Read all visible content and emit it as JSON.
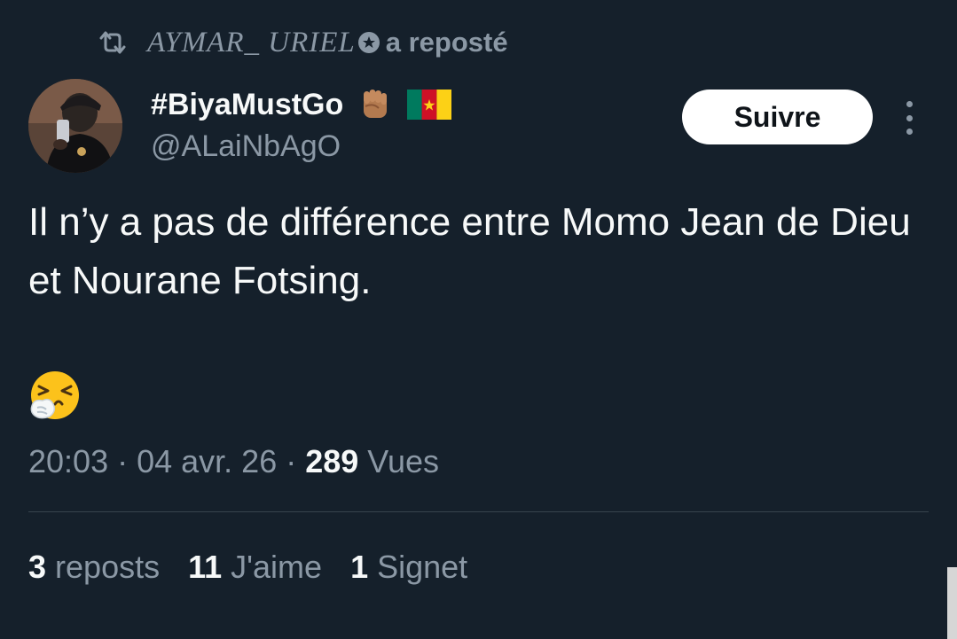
{
  "repost": {
    "reposter": "AYMAR_ URIEL",
    "action": "a reposté"
  },
  "author": {
    "display_name": "#BiyaMustGo",
    "handle": "@ALaiNbAgO"
  },
  "follow_label": "Suivre",
  "tweet": {
    "text": "Il n’y a pas de différence entre Momo Jean de Dieu et Nourane Fotsing."
  },
  "meta": {
    "time": "20:03",
    "separator": "·",
    "date": "04 avr. 26",
    "views_count": "289",
    "views_label": "Vues"
  },
  "stats": {
    "reposts_count": "3",
    "reposts_label": "reposts",
    "likes_count": "11",
    "likes_label": "J'aime",
    "bookmarks_count": "1",
    "bookmarks_label": "Signet"
  },
  "icons": {
    "repost": "repost-icon",
    "badge": "badge-icon",
    "fist": "raised-fist-emoji",
    "flag": "cameroon-flag-emoji",
    "sneeze": "sneezing-face-emoji",
    "more": "more-icon"
  },
  "colors": {
    "background": "#15202b",
    "text_primary": "#f7f9f9",
    "text_secondary": "#8b98a5",
    "divider": "#38444d",
    "follow_bg": "#ffffff"
  }
}
